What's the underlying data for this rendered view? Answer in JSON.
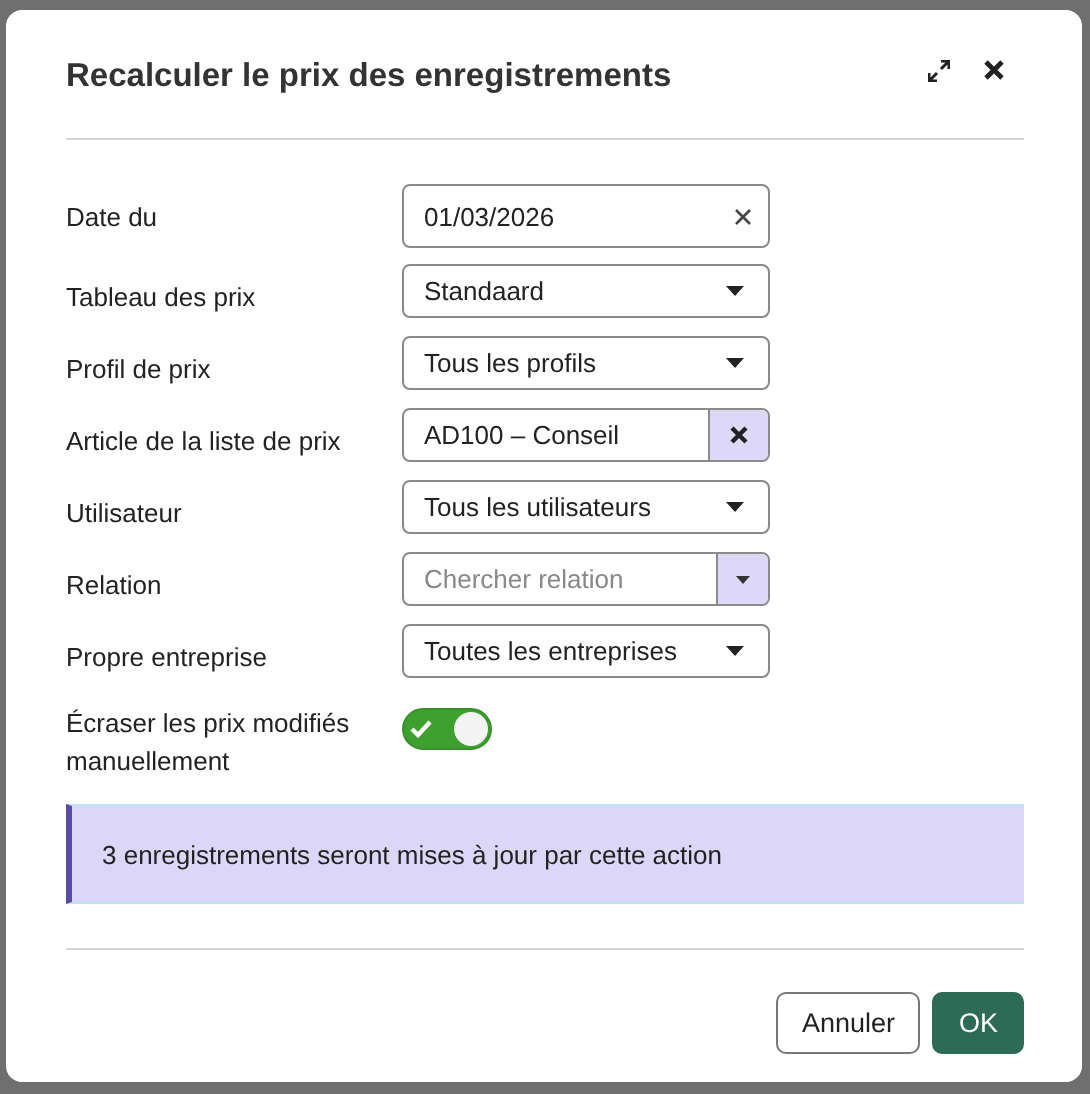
{
  "dialog": {
    "title": "Recalculer le prix des enregistrements",
    "fields": [
      {
        "kind": "date",
        "label": "Date du",
        "value": "01/03/2026"
      },
      {
        "kind": "select",
        "label": "Tableau des prix",
        "value": "Standaard"
      },
      {
        "kind": "select",
        "label": "Profil de prix",
        "value": "Tous les profils"
      },
      {
        "kind": "tag",
        "label": "Article de la liste de prix",
        "value": "AD100 – Conseil"
      },
      {
        "kind": "select",
        "label": "Utilisateur",
        "value": "Tous les utilisateurs"
      },
      {
        "kind": "search",
        "label": "Relation",
        "placeholder": "Chercher relation"
      },
      {
        "kind": "select",
        "label": "Propre entreprise",
        "value": "Toutes les entreprises"
      },
      {
        "kind": "toggle",
        "label": "Écraser les prix modifiés manuellement",
        "on": true
      }
    ],
    "info": "3 enregistrements seront mises à jour par cette action",
    "buttons": [
      {
        "kind": "secondary",
        "label": "Annuler"
      },
      {
        "kind": "primary",
        "label": "OK"
      }
    ]
  }
}
